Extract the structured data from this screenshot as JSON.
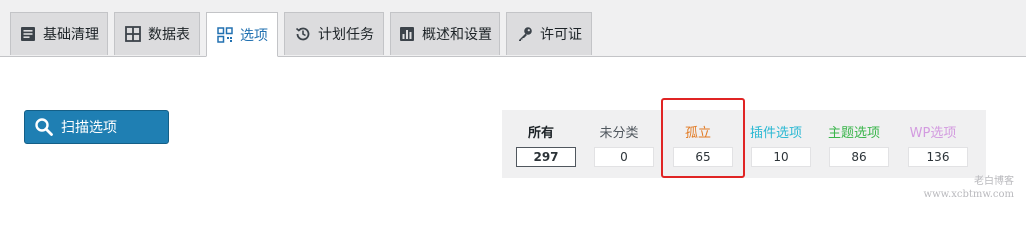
{
  "tabs": [
    {
      "label": "基础清理",
      "icon": "document-lines-icon",
      "active": false
    },
    {
      "label": "数据表",
      "icon": "table-grid-icon",
      "active": false
    },
    {
      "label": "选项",
      "icon": "qr-grid-icon",
      "active": true
    },
    {
      "label": "计划任务",
      "icon": "history-clock-icon",
      "active": false
    },
    {
      "label": "概述和设置",
      "icon": "chart-settings-icon",
      "active": false
    },
    {
      "label": "许可证",
      "icon": "key-icon",
      "active": false
    }
  ],
  "scan_button": {
    "label": "扫描选项",
    "icon": "search-icon"
  },
  "stats": [
    {
      "label": "所有",
      "value": "297",
      "color": "#1d2327"
    },
    {
      "label": "未分类",
      "value": "0",
      "color": "#50575e"
    },
    {
      "label": "孤立",
      "value": "65",
      "color": "#e2781f"
    },
    {
      "label": "插件选项",
      "value": "10",
      "color": "#2ab8d3"
    },
    {
      "label": "主题选项",
      "value": "86",
      "color": "#39b54a"
    },
    {
      "label": "WP选项",
      "value": "136",
      "color": "#d39be0"
    }
  ],
  "highlight_color": "#e02424",
  "watermark": {
    "line1": "老白博客",
    "line2": "www.xcbtmw.com"
  }
}
